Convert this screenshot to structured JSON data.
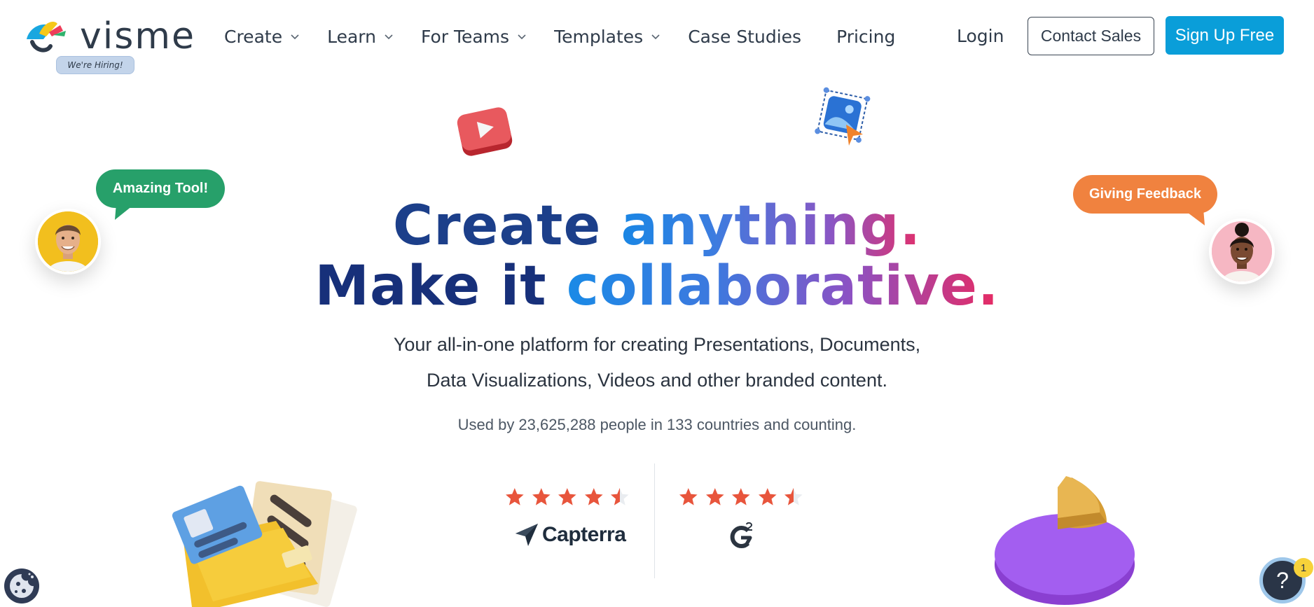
{
  "brand": {
    "name": "visme",
    "hiring_badge": "We're Hiring!",
    "colors": {
      "accent": "#0a9ed9",
      "dark_text": "#2f3b4a",
      "headline_dark": "#1c3f8a",
      "green": "#27a06a",
      "orange": "#f0823f"
    }
  },
  "nav": {
    "items": [
      {
        "label": "Create",
        "has_dropdown": true
      },
      {
        "label": "Learn",
        "has_dropdown": true
      },
      {
        "label": "For Teams",
        "has_dropdown": true
      },
      {
        "label": "Templates",
        "has_dropdown": true
      },
      {
        "label": "Case Studies",
        "has_dropdown": false
      },
      {
        "label": "Pricing",
        "has_dropdown": false
      }
    ],
    "login": "Login",
    "contact_sales": "Contact Sales",
    "sign_up": "Sign Up Free"
  },
  "hero": {
    "line1_dark": "Create",
    "line1_gradient": "anything.",
    "line2_dark": "Make it",
    "line2_gradient": "collaborative.",
    "subtitle_line1": "Your all-in-one platform for creating Presentations, Documents,",
    "subtitle_line2": "Data Visualizations, Videos and other branded content.",
    "usage": "Used by 23,625,288 people in 133 countries and counting."
  },
  "ratings": [
    {
      "source": "Capterra",
      "stars": 4.5
    },
    {
      "source": "G2",
      "stars": 4.5
    }
  ],
  "testimonials": {
    "left_bubble": "Amazing Tool!",
    "right_bubble": "Giving Feedback"
  },
  "icons": [
    "visme-logo-icon",
    "chevron-down-icon",
    "play-icon",
    "image-select-icon",
    "star-icon",
    "capterra-logo-icon",
    "g2-logo-icon",
    "folder-icon",
    "pie-chart-icon",
    "cookie-icon",
    "help-icon"
  ],
  "help": {
    "label": "?",
    "badge_count": "1"
  }
}
